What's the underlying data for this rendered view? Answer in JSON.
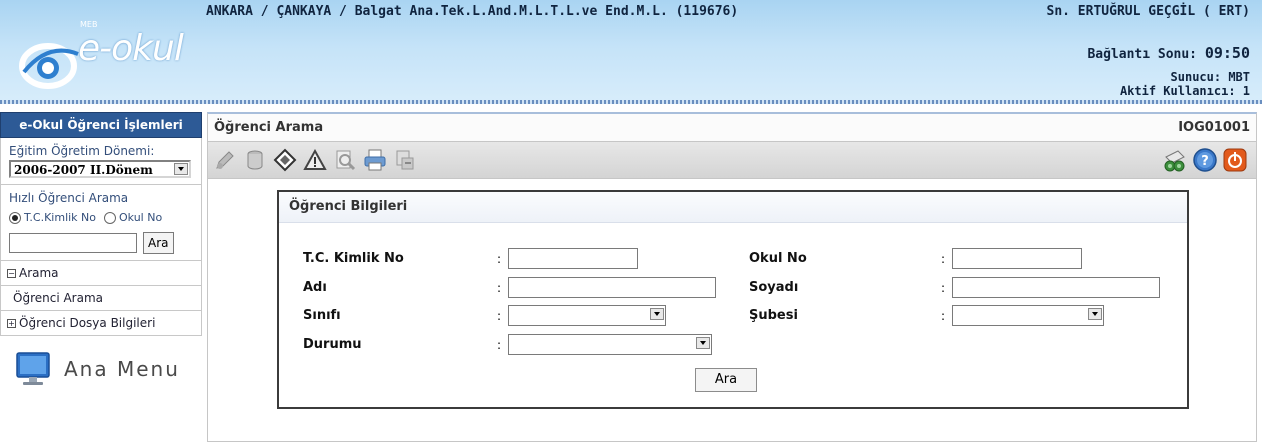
{
  "header": {
    "brand_small": "MEB",
    "brand": "e-okul",
    "school_line": "ANKARA / ÇANKAYA / Balgat Ana.Tek.L.And.M.L.T.L.ve End.M.L. (119676)",
    "user": "Sn. ERTUĞRUL GEÇGİL ( ERT)",
    "connection_label": "Bağlantı Sonu: ",
    "connection_time": "09:50",
    "server": "Sunucu: MBT",
    "active_users": "Aktif Kullanıcı: 1"
  },
  "sidebar": {
    "title": "e-Okul Öğrenci İşlemleri",
    "term_label": "Eğitim Öğretim Dönemi:",
    "term_value": "2006-2007 II.Dönem",
    "quick_search_label": "Hızlı Öğrenci Arama",
    "radio_tc": "T.C.Kimlik No",
    "radio_okul": "Okul No",
    "search_button": "Ara",
    "menu": {
      "arama": "Arama",
      "ogrenci_arama": "Öğrenci Arama",
      "dosya": "Öğrenci Dosya Bilgileri"
    },
    "ana_menu": "Ana Menu"
  },
  "main": {
    "title": "Öğrenci Arama",
    "code": "IOG01001",
    "panel_title": "Öğrenci Bilgileri",
    "fields": {
      "tc": "T.C. Kimlik No",
      "okul_no": "Okul No",
      "adi": "Adı",
      "soyadi": "Soyadı",
      "sinifi": "Sınıfı",
      "subesi": "Şubesi",
      "durumu": "Durumu"
    },
    "colon": ":",
    "ara_button": "Ara"
  },
  "icons": {
    "toolbar_left": [
      "edit-icon",
      "database-icon",
      "eraser-icon",
      "warning-icon",
      "search-preview-icon",
      "print-icon",
      "export-icon"
    ],
    "toolbar_right": [
      "binoculars-icon",
      "help-icon",
      "exit-icon"
    ]
  },
  "colors": {
    "header_blue": "#a9d4f2",
    "sidebar_title": "#2d5a96"
  }
}
